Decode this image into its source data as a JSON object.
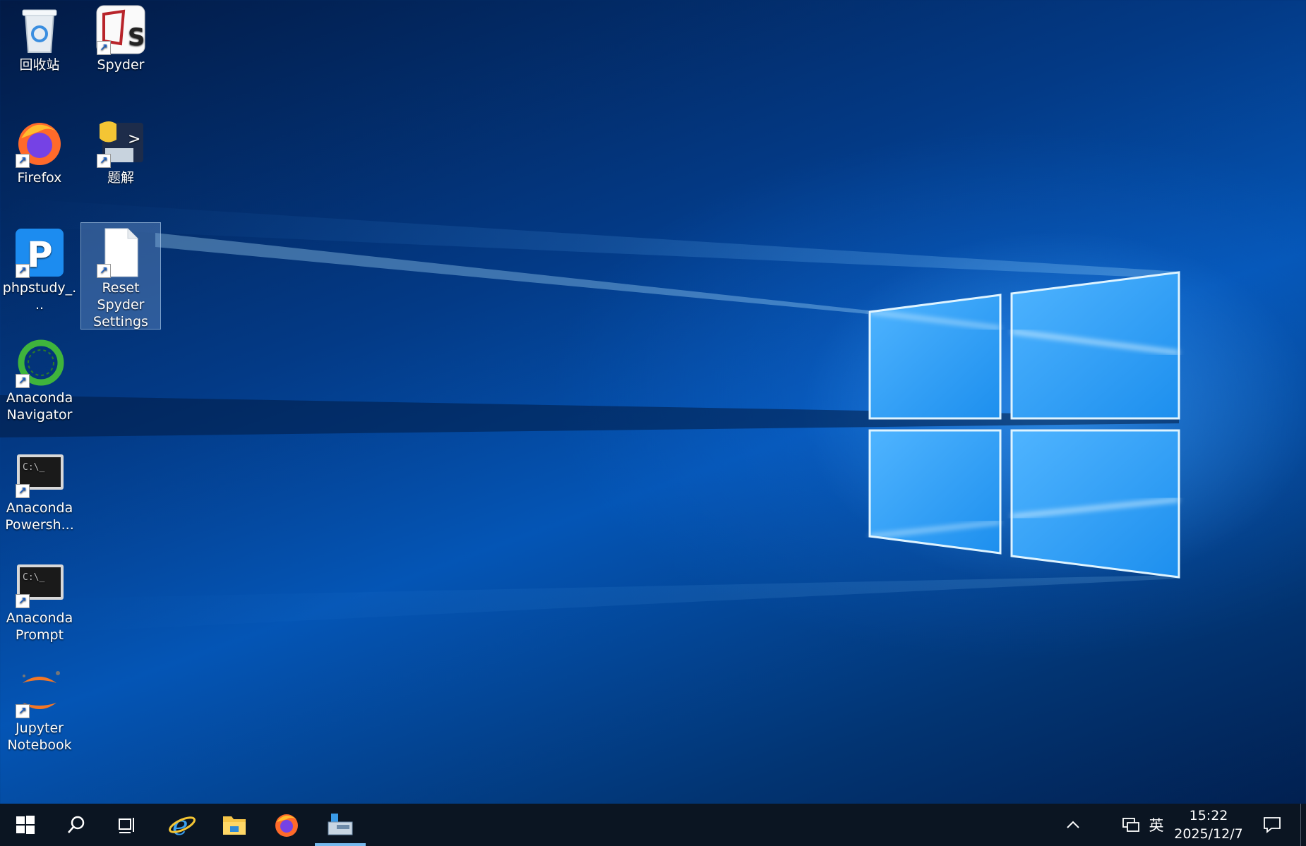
{
  "desktop": {
    "icons": [
      {
        "id": "recycle-bin",
        "label": "回收站",
        "icon": "recycle-bin-icon",
        "shortcut": false
      },
      {
        "id": "spyder",
        "label": "Spyder",
        "icon": "spyder-icon",
        "shortcut": true
      },
      {
        "id": "firefox",
        "label": "Firefox",
        "icon": "firefox-icon",
        "shortcut": true
      },
      {
        "id": "tijie",
        "label": "题解",
        "icon": "python-launcher-icon",
        "shortcut": true
      },
      {
        "id": "phpstudy",
        "label": "phpstudy_...",
        "icon": "phpstudy-icon",
        "shortcut": true
      },
      {
        "id": "reset-spyder",
        "label": "Reset Spyder Settings",
        "icon": "blank-document-icon",
        "shortcut": true,
        "selected": true
      },
      {
        "id": "anaconda-navigator",
        "label": "Anaconda Navigator",
        "icon": "anaconda-icon",
        "shortcut": true
      },
      {
        "id": "anaconda-powershell",
        "label": "Anaconda Powersh...",
        "icon": "terminal-icon",
        "shortcut": true
      },
      {
        "id": "anaconda-prompt",
        "label": "Anaconda Prompt",
        "icon": "terminal-icon",
        "shortcut": true
      },
      {
        "id": "jupyter",
        "label": "Jupyter Notebook",
        "icon": "jupyter-icon",
        "shortcut": true
      }
    ]
  },
  "taskbar": {
    "pinned": [
      "start-icon",
      "search-icon",
      "task-view-icon",
      "internet-explorer-icon",
      "file-explorer-icon",
      "firefox-icon",
      "tool-app-icon"
    ],
    "active": "tool-app-icon",
    "tray": {
      "chevron": "chevron-up-icon",
      "network": "network-icon",
      "ime": "英",
      "time": "15:22",
      "date": "2025/12/7",
      "notification": "action-center-icon"
    }
  },
  "colors": {
    "accent": "#76b9ed",
    "taskbar": "#0b1522",
    "selection": "#7fa6d6"
  }
}
